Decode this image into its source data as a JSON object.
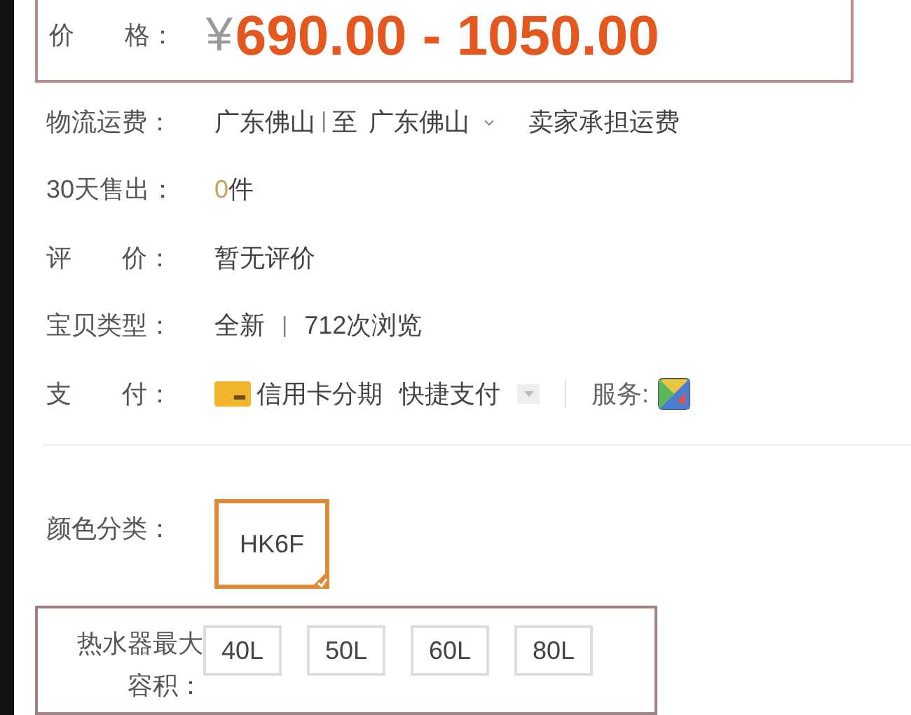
{
  "price": {
    "label": "价　　格：",
    "currency": "¥",
    "value": "690.00 - 1050.00"
  },
  "shipping": {
    "label": "物流运费：",
    "from": "广东佛山",
    "separator": "|",
    "to_word": "至",
    "to": "广东佛山",
    "fee": "卖家承担运费"
  },
  "sales": {
    "label": "30天售出：",
    "count": "0",
    "unit": "件"
  },
  "rating": {
    "label": "评　　价：",
    "value": "暂无评价"
  },
  "item_type": {
    "label": "宝贝类型：",
    "condition": "全新",
    "separator": "|",
    "views": "712次浏览"
  },
  "payment": {
    "label": "支　　付：",
    "methods": [
      "信用卡分期",
      "快捷支付"
    ],
    "service_label": "服务:"
  },
  "color_options": {
    "label": "颜色分类：",
    "options": [
      {
        "label": "HK6F",
        "selected": true
      }
    ]
  },
  "capacity_options": {
    "label_lines": [
      "热水器最大",
      "容积："
    ],
    "options": [
      {
        "label": "40L",
        "selected": false
      },
      {
        "label": "50L",
        "selected": false
      },
      {
        "label": "60L",
        "selected": false
      },
      {
        "label": "80L",
        "selected": false
      }
    ]
  }
}
